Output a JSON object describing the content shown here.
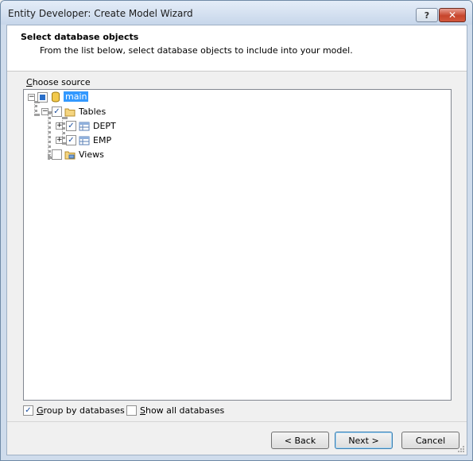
{
  "window": {
    "title": "Entity Developer: Create Model Wizard",
    "help_label": "?",
    "close_label": "✕"
  },
  "header": {
    "title": "Select database objects",
    "subtitle": "From the list below, select database objects to include into your model."
  },
  "choose_source": {
    "first_letter": "C",
    "rest": "hoose source"
  },
  "tree": {
    "root": {
      "label": "main",
      "state": "partial"
    },
    "tables": {
      "label": "Tables",
      "checked": "✓"
    },
    "dept": {
      "label": "DEPT",
      "checked": "✓"
    },
    "emp": {
      "label": "EMP",
      "checked": "✓"
    },
    "views": {
      "label": "Views"
    },
    "collapse_glyph": "−",
    "expand_glyph": "+"
  },
  "options": {
    "group_by": {
      "first": "G",
      "rest": "roup by databases",
      "checked": "✓"
    },
    "show_all": {
      "first": "S",
      "rest": "how all databases"
    }
  },
  "buttons": {
    "back": "< Back",
    "next": "Next >",
    "cancel": "Cancel"
  },
  "colors": {
    "selection": "#3399ff",
    "titlebar": "#c7d6ea",
    "close": "#c7452c"
  }
}
